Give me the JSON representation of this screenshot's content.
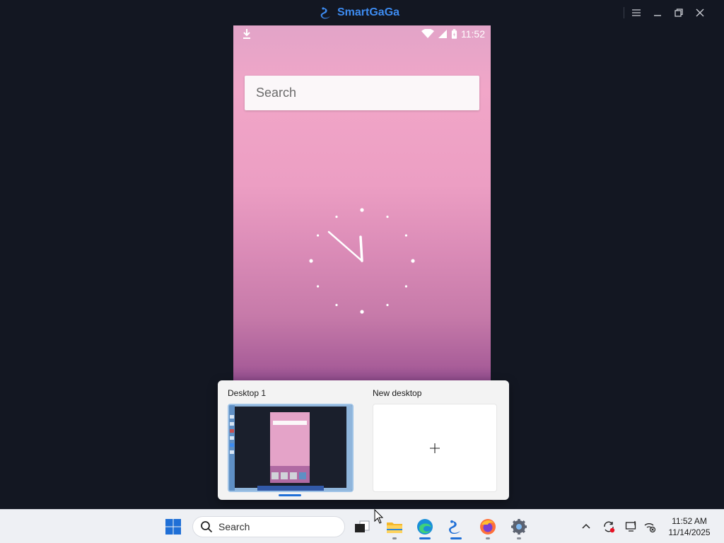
{
  "window": {
    "app_name": "SmartGaGa",
    "buttons": [
      "menu-icon",
      "minimize-icon",
      "restore-icon",
      "close-icon"
    ]
  },
  "android": {
    "status_time": "11:52",
    "search_placeholder": "Search",
    "status_icons": [
      "download-icon",
      "wifi-icon",
      "cell-signal-icon",
      "battery-icon"
    ]
  },
  "task_view": {
    "desktops": [
      {
        "label": "Desktop 1"
      },
      {
        "label": "New desktop"
      }
    ]
  },
  "taskbar": {
    "search_placeholder": "Search",
    "apps": [
      "start-icon",
      "task-view-icon",
      "file-explorer-icon",
      "edge-icon",
      "smartgaga-icon",
      "firefox-icon",
      "settings-icon"
    ],
    "tray": [
      "chevron-up-icon",
      "sync-icon",
      "display-icon",
      "network-icon"
    ],
    "clock_time": "11:52 AM",
    "clock_date": "11/14/2025"
  },
  "colors": {
    "brand": "#3d8bf0",
    "accent": "#1f6fd6",
    "emulator_bg": "#131722"
  }
}
